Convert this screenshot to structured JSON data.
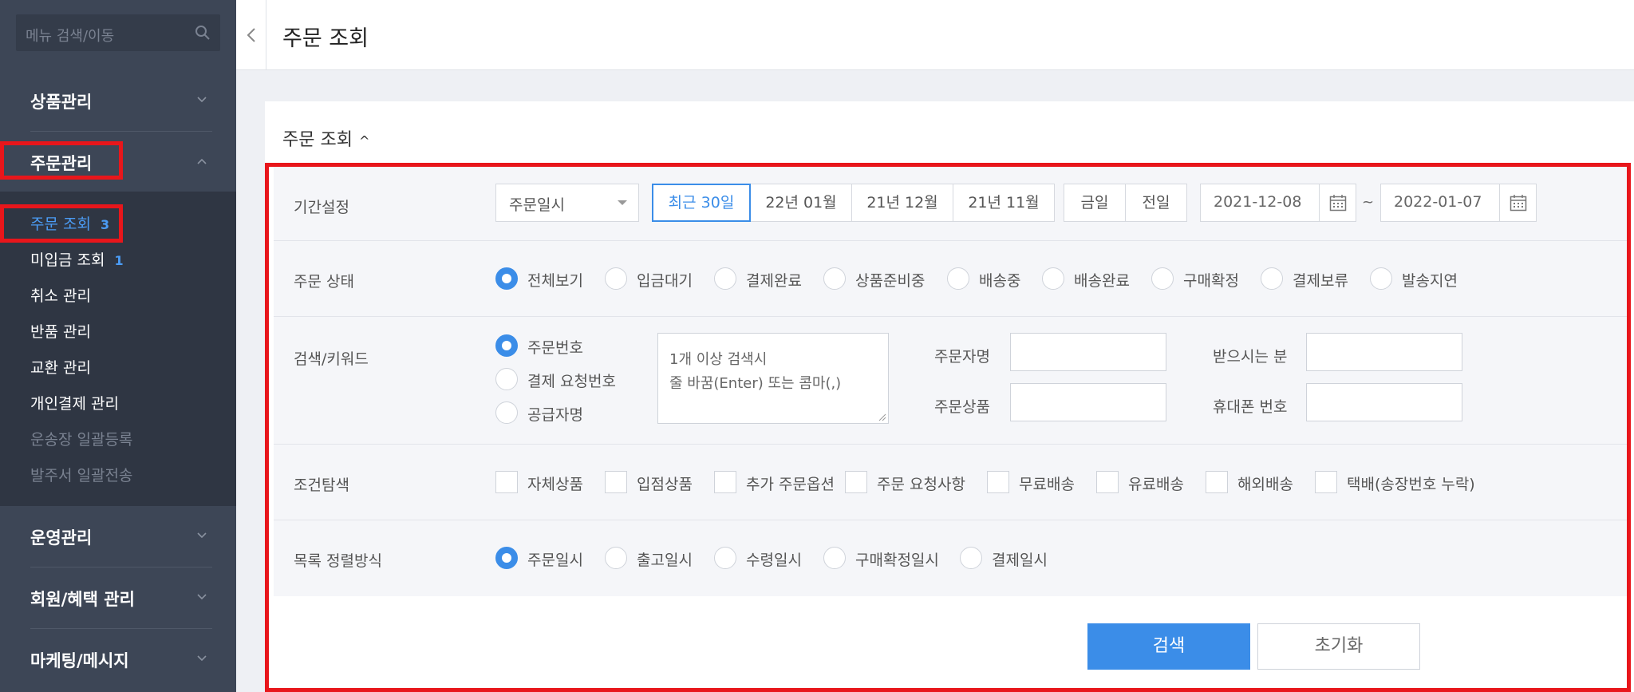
{
  "sidebar": {
    "search_placeholder": "메뉴 검색/이동",
    "groups": {
      "product": "상품관리",
      "order": "주문관리",
      "operation": "운영관리",
      "member": "회원/혜택 관리",
      "marketing": "마케팅/메시지"
    },
    "subitems": [
      {
        "label": "주문 조회",
        "count": "3"
      },
      {
        "label": "미입금 조회",
        "count": "1"
      },
      {
        "label": "취소 관리"
      },
      {
        "label": "반품 관리"
      },
      {
        "label": "교환 관리"
      },
      {
        "label": "개인결제 관리"
      },
      {
        "label": "운송장 일괄등록"
      },
      {
        "label": "발주서 일괄전송"
      }
    ]
  },
  "header": {
    "title": "주문 조회"
  },
  "card": {
    "title": "주문 조회",
    "caret": "^"
  },
  "filters": {
    "period": {
      "label": "기간설정",
      "select": "주문일시",
      "buttons": [
        "최근 30일",
        "22년 01월",
        "21년 12월",
        "21년 11월"
      ],
      "quick": [
        "금일",
        "전일"
      ],
      "start": "2021-12-08",
      "tilde": "~",
      "end": "2022-01-07"
    },
    "status": {
      "label": "주문 상태",
      "options": [
        "전체보기",
        "입금대기",
        "결제완료",
        "상품준비중",
        "배송중",
        "배송완료",
        "구매확정",
        "결제보류",
        "발송지연"
      ]
    },
    "keyword": {
      "label": "검색/키워드",
      "options": [
        "주문번호",
        "결제 요청번호",
        "공급자명"
      ],
      "textarea_line1": "1개 이상 검색시",
      "textarea_line2": "줄 바꿈(Enter) 또는 콤마(,)",
      "orderer": "주문자명",
      "receiver": "받으시는 분",
      "product": "주문상품",
      "phone": "휴대폰 번호"
    },
    "condition": {
      "label": "조건탐색",
      "options": [
        "자체상품",
        "입점상품",
        "추가 주문옵션",
        "주문 요청사항",
        "무료배송",
        "유료배송",
        "해외배송",
        "택배(송장번호 누락)"
      ]
    },
    "sort": {
      "label": "목록 정렬방식",
      "options": [
        "주문일시",
        "출고일시",
        "수령일시",
        "구매확정일시",
        "결제일시"
      ]
    }
  },
  "buttons": {
    "search": "검색",
    "reset": "초기화"
  },
  "colors": {
    "accent": "#3b8de8",
    "highlight": "#e8161b",
    "sidebar": "#3d4656"
  }
}
